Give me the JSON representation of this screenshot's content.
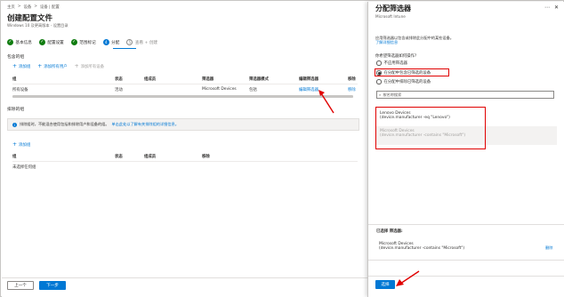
{
  "breadcrumb": [
    "主页",
    "设备",
    "设备 | 配置"
  ],
  "page": {
    "title": "创建配置文件",
    "subtitle": "Windows 10 及更高版本 - 设置目录"
  },
  "steps": [
    {
      "label": "基本信息",
      "state": "done",
      "mark": "✓"
    },
    {
      "label": "配置设置",
      "state": "done",
      "mark": "✓"
    },
    {
      "label": "范围标记",
      "state": "done",
      "mark": "✓"
    },
    {
      "label": "分配",
      "state": "current",
      "mark": "4"
    },
    {
      "label": "查看 + 创建",
      "state": "todo",
      "mark": "5"
    }
  ],
  "included": {
    "label": "包含的组",
    "add_groups": "添加组",
    "add_all_users": "添加所有用户",
    "add_all_devices": "添加所有设备",
    "columns": [
      "组",
      "组成员",
      "筛选器",
      "筛选器模式",
      "编辑筛选器",
      "移除"
    ],
    "columns_full": {
      "group": "组",
      "status": "状态",
      "members": "组成员",
      "filter": "筛选器",
      "filter_mode": "筛选器模式",
      "edit_filter": "编辑筛选器",
      "remove": "移除"
    },
    "row": {
      "group": "所有设备",
      "status": "活动",
      "members": "",
      "filter": "Microsoft Devices",
      "filter_mode": "包括",
      "edit_filter": "编辑筛选器",
      "remove": "移除"
    }
  },
  "excluded": {
    "label": "排除的组",
    "info_text": "排除组时，不能混合使用包括和排除用户和设备的组。",
    "info_link": "单击此处以了解有关排除组的详细信息。",
    "add_groups": "添加组",
    "columns": {
      "group": "组",
      "status": "状态",
      "members": "组成员",
      "remove": "移除"
    },
    "empty_text": "未选择任何组"
  },
  "footer": {
    "prev": "上一个",
    "next": "下一步"
  },
  "panel": {
    "title": "分配筛选器",
    "subtitle": "Microsoft Intune",
    "description": "应用筛选器以包含或排除此分配中的某些设备。",
    "learn_more": "了解详细信息",
    "question": "你希望筛选器如何操作?",
    "options": [
      {
        "label": "不应用筛选器",
        "selected": false
      },
      {
        "label": "在分配中包含已筛选的设备",
        "selected": true
      },
      {
        "label": "在分配中排除已筛选的设备",
        "selected": false
      }
    ],
    "search_placeholder": "按名称搜索",
    "filters": [
      {
        "name": "Lenovo Devices",
        "rule": "(device.manufacturer -eq \"Lenovo\")",
        "disabled": false
      },
      {
        "name": "Microsoft Devices",
        "rule": "(device.manufacturer -contains \"Microsoft\")",
        "disabled": true
      }
    ],
    "selected_label": "已选择 筛选器:",
    "selected": {
      "name": "Microsoft Devices",
      "rule": "(device.manufacturer -contains \"Microsoft\")"
    },
    "remove": "删除",
    "select_button": "选择"
  },
  "colors": {
    "accent": "#0078d4",
    "done": "#107c10",
    "annotation": "#e00000"
  }
}
